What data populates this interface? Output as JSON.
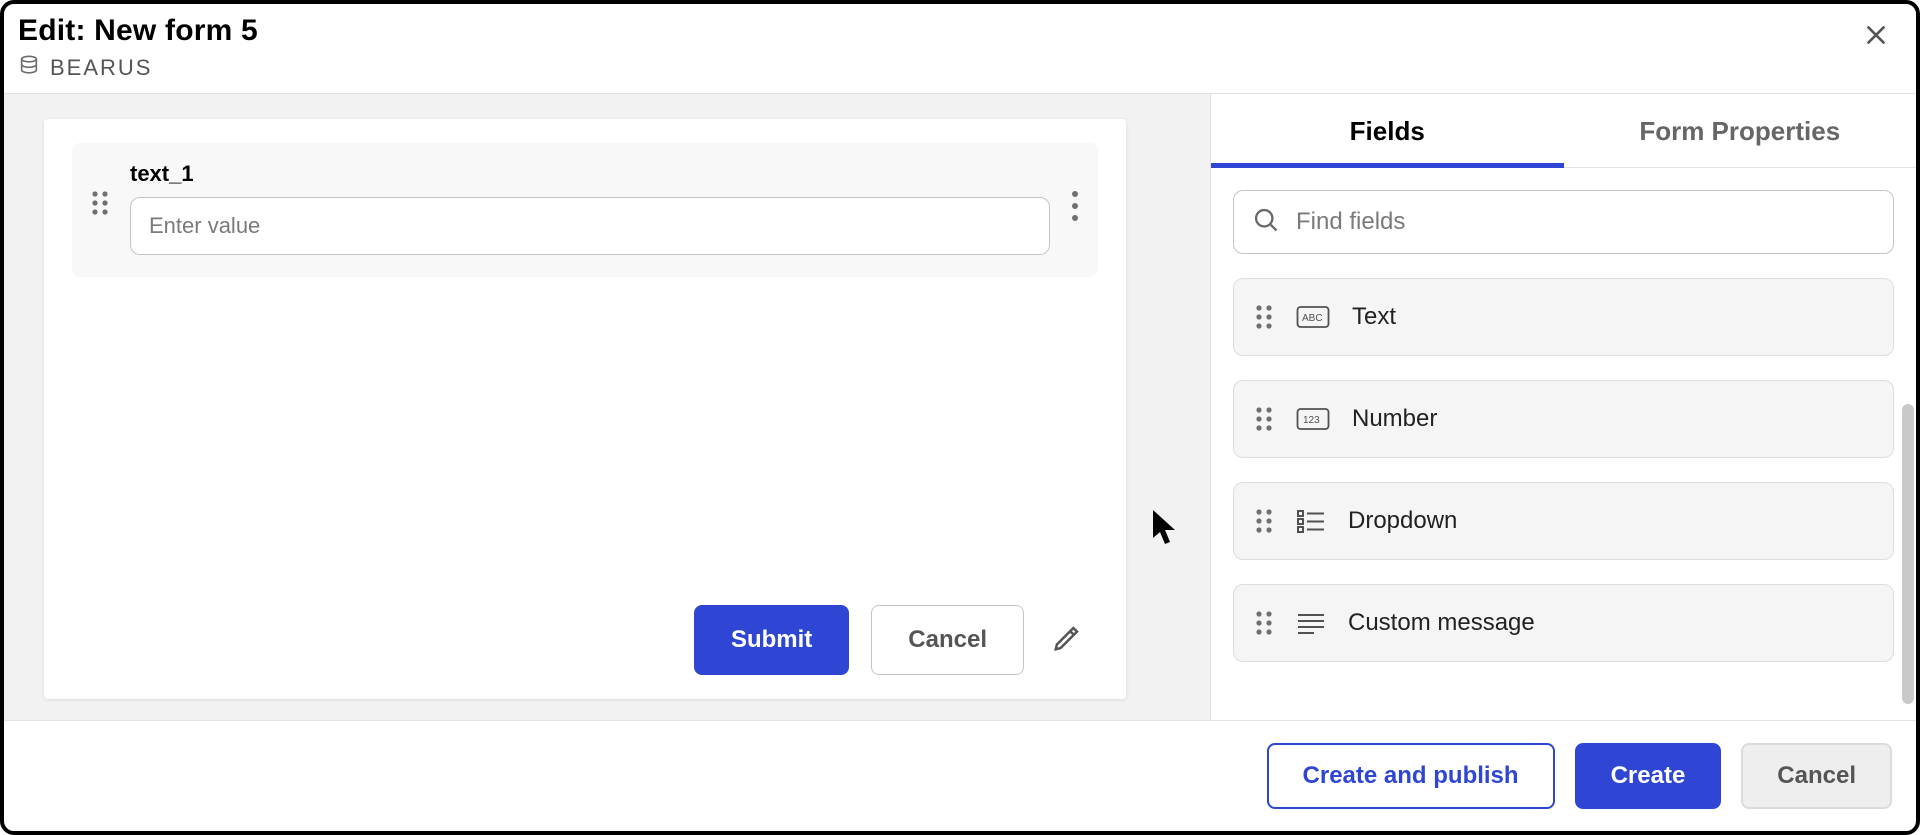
{
  "header": {
    "title": "Edit: New form 5",
    "database_name": "BEARUS"
  },
  "form": {
    "fields": [
      {
        "label": "text_1",
        "placeholder": "Enter value"
      }
    ],
    "actions": {
      "submit": "Submit",
      "cancel": "Cancel"
    }
  },
  "side": {
    "tabs": {
      "fields": "Fields",
      "properties": "Form Properties"
    },
    "search_placeholder": "Find fields",
    "field_types": [
      {
        "id": "text",
        "label": "Text"
      },
      {
        "id": "number",
        "label": "Number"
      },
      {
        "id": "dropdown",
        "label": "Dropdown"
      },
      {
        "id": "custom_message",
        "label": "Custom message"
      }
    ]
  },
  "footer": {
    "create_publish": "Create and publish",
    "create": "Create",
    "cancel": "Cancel"
  }
}
